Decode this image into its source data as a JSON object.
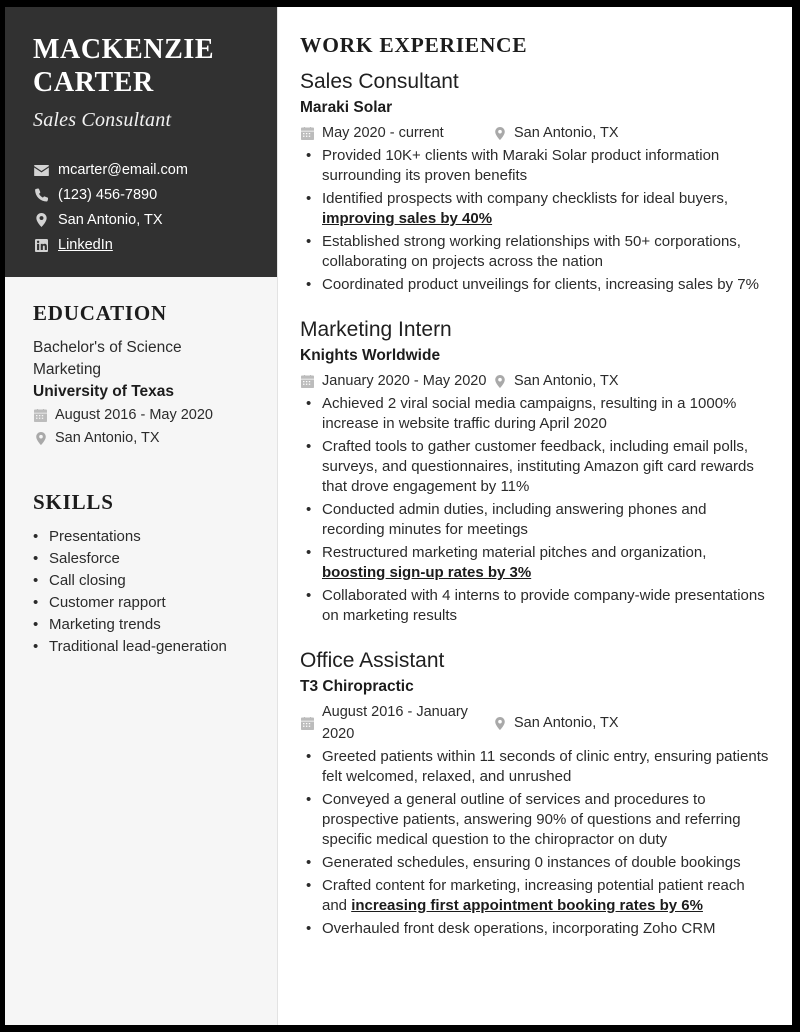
{
  "theme": {
    "sidebar_dark": "#313131",
    "sidebar_light": "#f6f6f6",
    "page_border": "#000000",
    "text_primary": "#1c1c1c",
    "text_body": "#2b2b2b",
    "icon_muted": "#bcbcbc"
  },
  "header": {
    "name_first": "MACKENZIE",
    "name_last": "CARTER",
    "title": "Sales Consultant"
  },
  "contact": [
    {
      "icon": "envelope-icon",
      "label": "mcarter@email.com",
      "link": false
    },
    {
      "icon": "phone-icon",
      "label": "(123) 456-7890",
      "link": false
    },
    {
      "icon": "map-pin-icon",
      "label": "San Antonio, TX",
      "link": false
    },
    {
      "icon": "linkedin-icon",
      "label": "LinkedIn",
      "link": true
    }
  ],
  "education": {
    "heading": "EDUCATION",
    "degree": "Bachelor's of Science",
    "major": "Marketing",
    "school": "University of Texas",
    "dates": "August 2016 - May 2020",
    "location": "San Antonio, TX"
  },
  "skills": {
    "heading": "SKILLS",
    "items": [
      "Presentations",
      "Salesforce",
      "Call closing",
      "Customer rapport",
      "Marketing trends",
      "Traditional lead-generation"
    ]
  },
  "work": {
    "heading": "WORK EXPERIENCE",
    "jobs": [
      {
        "role": "Sales Consultant",
        "company": "Maraki Solar",
        "dates": "May 2020 - current",
        "location": "San Antonio, TX",
        "bullets": [
          "Provided 10K+ clients with Maraki Solar product information surrounding its proven benefits",
          "Identified prospects with company checklists for ideal buyers, <u>improving sales by 40%</u>",
          "Established strong working relationships with 50+ corporations, collaborating on projects across the nation",
          "Coordinated product unveilings for clients, increasing sales by 7%"
        ]
      },
      {
        "role": "Marketing Intern",
        "company": "Knights Worldwide",
        "dates": "January 2020 - May 2020",
        "location": "San Antonio, TX",
        "bullets": [
          "Achieved 2 viral social media campaigns, resulting in a 1000% increase in website traffic during April 2020",
          "Crafted tools to gather customer feedback, including email polls, surveys, and questionnaires, instituting Amazon gift card rewards that drove engagement by 11%",
          "Conducted admin duties, including answering phones and recording minutes for meetings",
          "Restructured marketing material pitches and organization, <u>boosting sign-up rates by 3%</u>",
          "Collaborated with 4 interns to provide company-wide presentations on marketing results"
        ]
      },
      {
        "role": "Office Assistant",
        "company": "T3 Chiropractic",
        "dates": "August 2016 - January 2020",
        "location": "San Antonio, TX",
        "bullets": [
          "Greeted patients within 11 seconds of clinic entry, ensuring patients felt welcomed, relaxed, and unrushed",
          "Conveyed a general outline of services and procedures to prospective patients, answering 90% of questions and referring specific medical question to the chiropractor on duty",
          "Generated schedules, ensuring 0 instances of double bookings",
          "Crafted content for marketing, increasing potential patient reach and <u>increasing first appointment booking rates by 6%</u>",
          "Overhauled front desk operations, incorporating Zoho CRM"
        ]
      }
    ]
  },
  "glyphs": {
    "bullet": "•"
  }
}
